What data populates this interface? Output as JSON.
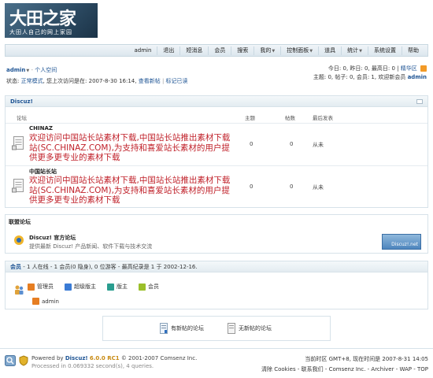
{
  "logo": {
    "title": "大田之家",
    "tagline": "大田人自己的网上家园"
  },
  "topnav": [
    {
      "label": "admin",
      "dropdown": false
    },
    {
      "label": "退出",
      "dropdown": false
    },
    {
      "label": "短消息",
      "dropdown": false
    },
    {
      "label": "会员",
      "dropdown": false
    },
    {
      "label": "搜索",
      "dropdown": false
    },
    {
      "label": "我的",
      "dropdown": true
    },
    {
      "label": "控制面板",
      "dropdown": true
    },
    {
      "label": "道具",
      "dropdown": false
    },
    {
      "label": "统计",
      "dropdown": true
    },
    {
      "label": "系统设置",
      "dropdown": false
    },
    {
      "label": "帮助",
      "dropdown": false
    }
  ],
  "userbar": {
    "username": "admin",
    "space_link": "个人空间",
    "status_prefix": "状态:",
    "mode_link": "正常模式",
    "last_visit": ", 您上次访问是在: 2007-8-30 16:14,",
    "new_posts": "查看新帖",
    "mark_read": "标记已读"
  },
  "right_info": {
    "line1": "今日: 0, 昨日: 0, 最高日: 0",
    "digest": "精华区",
    "line2_prefix": "主题: 0, 帖子: 0, 会员: 1, 欢迎新会员",
    "new_member": "admin"
  },
  "category": {
    "name": "Discuz!",
    "headers": {
      "forum": "论坛",
      "threads": "主题",
      "posts": "帖数",
      "lastpost": "最后发表"
    },
    "forums": [
      {
        "name": "CHINAZ",
        "description": "欢迎访问中国站长站素材下载,中国站长站推出素材下载站(SC.CHINAZ.COM),为支持和喜爱站长素材的用户提供更多更专业的素材下载",
        "threads": "0",
        "posts": "0",
        "lastpost": "从未"
      },
      {
        "name": "中国站长站",
        "description": "欢迎访问中国站长站素材下载,中国站长站推出素材下载站(SC.CHINAZ.COM),为支持和喜爱站长素材的用户提供更多更专业的素材下载",
        "threads": "0",
        "posts": "0",
        "lastpost": "从未"
      }
    ]
  },
  "league": {
    "title": "联盟论坛",
    "forum_name": "Discuz! 官方论坛",
    "forum_desc": "提供最新  Discuz! 产品新闻、软件下载与技术交流",
    "badge": "Discuz!.net"
  },
  "members": {
    "title": "会员",
    "summary": "- 1 人在线 - 1 会员(0 隐身), 0 位游客 - 最高纪录是 1 于  2002-12-16.",
    "groups": [
      {
        "label": "管理员",
        "color": "#e67e22"
      },
      {
        "label": "超级版主",
        "color": "#3a7bd5"
      },
      {
        "label": "版主",
        "color": "#2a9d8f"
      },
      {
        "label": "会员",
        "color": "#9bbf2a"
      }
    ],
    "online_user": "admin"
  },
  "legend": {
    "new": "有新帖的论坛",
    "none": "无新帖的论坛"
  },
  "footer": {
    "powered_by": "Powered by",
    "product": "Discuz!",
    "version": "6.0.0 RC1",
    "copyright": "© 2001-2007",
    "company": "Comsenz Inc.",
    "processed": "Processed in 0.069332 second(s), 4 queries.",
    "timezone": "当前时区  GMT+8, 现在时间是  2007-8-31 14:05",
    "links": "清除 Cookies - 联系我们 - Comsenz Inc. - Archiver - WAP - TOP"
  }
}
